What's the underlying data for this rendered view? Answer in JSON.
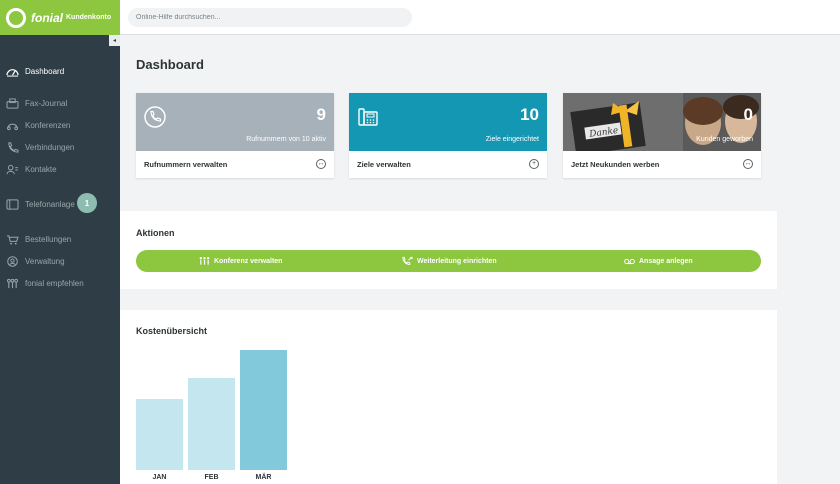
{
  "header": {
    "brand_name": "fonial",
    "brand_sub": "Kundenkonto",
    "search_placeholder": "Online-Hilfe durchsuchen..."
  },
  "sidebar": {
    "collapse_glyph": "◂",
    "items": [
      {
        "label": "Dashboard",
        "icon": "dashboard-icon"
      },
      {
        "label": "Fax-Journal",
        "icon": "fax-icon"
      },
      {
        "label": "Konferenzen",
        "icon": "conference-icon"
      },
      {
        "label": "Verbindungen",
        "icon": "phone-icon"
      },
      {
        "label": "Kontakte",
        "icon": "contacts-icon"
      },
      {
        "label": "Telefonanlage",
        "icon": "pbx-icon",
        "badge": "1"
      },
      {
        "label": "Bestellungen",
        "icon": "cart-icon"
      },
      {
        "label": "Verwaltung",
        "icon": "user-icon"
      },
      {
        "label": "fonial empfehlen",
        "icon": "people-icon"
      }
    ]
  },
  "main": {
    "title": "Dashboard",
    "tiles": [
      {
        "number": "9",
        "desc": "Rufnummern von 10 aktiv",
        "label": "Rufnummern verwalten",
        "color": "#a6b1b9",
        "icon": "phone-icon",
        "arrow": "↔"
      },
      {
        "number": "10",
        "desc": "Ziele eingerichtet",
        "label": "Ziele verwalten",
        "color": "#1497b3",
        "icon": "deskphone-icon",
        "arrow": "+"
      },
      {
        "number": "0",
        "desc": "Kunden geworben",
        "label": "Jetzt Neukunden werben",
        "color": "#4d4d4d",
        "icon": "gift-photo",
        "arrow": "↔",
        "photo_text": "Danke"
      }
    ],
    "actions": {
      "title": "Aktionen",
      "items": [
        {
          "label": "Konferenz verwalten",
          "icon": "conference-icon"
        },
        {
          "label": "Weiterleitung einrichten",
          "icon": "forward-icon"
        },
        {
          "label": "Ansage anlegen",
          "icon": "voicemail-icon"
        }
      ]
    },
    "costs": {
      "title": "Kostenübersicht"
    }
  },
  "chart_data": {
    "type": "bar",
    "categories": [
      "JAN",
      "FEB",
      "MÄR"
    ],
    "values": [
      59,
      77,
      100
    ],
    "ylim": [
      0,
      100
    ],
    "colors": [
      "#c4e6ee",
      "#c4e6ee",
      "#82c9db"
    ]
  }
}
